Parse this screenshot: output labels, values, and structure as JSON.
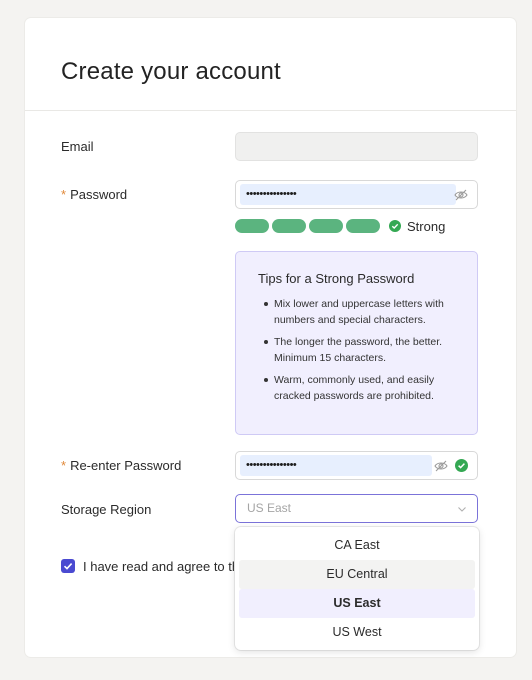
{
  "title": "Create your account",
  "email": {
    "label": "Email",
    "value": ""
  },
  "password": {
    "required_mark": "*",
    "label": "Password",
    "value": "•••••••••••••••",
    "strength": {
      "segments": 4,
      "filled": 4,
      "label": "Strong"
    }
  },
  "tips": {
    "title": "Tips for a Strong Password",
    "items": [
      "Mix lower and uppercase letters with numbers and special characters.",
      "The longer the password, the better. Minimum 15 characters.",
      "Warm, commonly used, and easily cracked passwords are prohibited."
    ]
  },
  "reenter": {
    "required_mark": "*",
    "label": "Re-enter Password",
    "value": "•••••••••••••••"
  },
  "storage": {
    "label": "Storage Region",
    "placeholder": "US East",
    "options": [
      "CA East",
      "EU Central",
      "US East",
      "US West"
    ],
    "selected": "US East",
    "hovered": "EU Central"
  },
  "agree": {
    "checked": true,
    "text": "I have read and agree to th"
  },
  "colors": {
    "accent": "#4a4ad1",
    "strength_green": "#5bb47f",
    "success_green": "#34a853",
    "required_orange": "#e0893a",
    "tips_bg": "#f1effe"
  },
  "icons": {
    "password_toggle": "eye-off-icon",
    "match": "check-circle-icon",
    "strength": "check-circle-icon",
    "select": "chevron-down-icon",
    "checkbox": "checkmark-icon"
  }
}
